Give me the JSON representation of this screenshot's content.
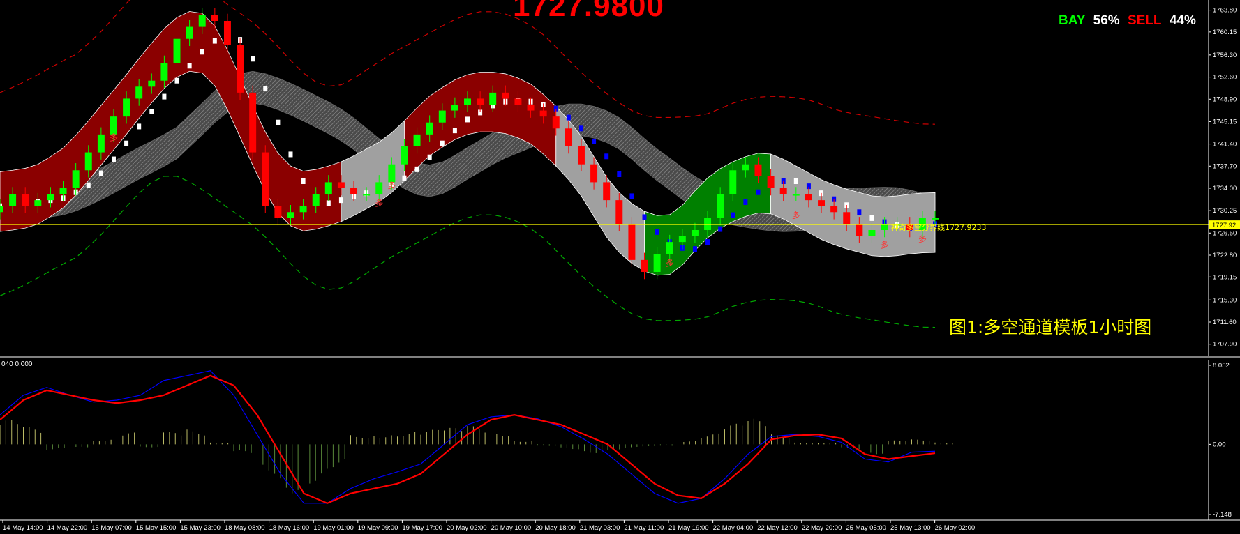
{
  "header": {
    "current_price": "1727.9800",
    "bay_label": "BAY",
    "bay_pct": "56%",
    "sell_label": "SELL",
    "sell_pct": "44%"
  },
  "caption": "图1:多空通道模板1小时图",
  "indicator_label": "040 0.000",
  "threshold_line_label": "神奇多空分界线1727.9233",
  "current_price_tag": "1727.92",
  "colors": {
    "background": "#000000",
    "bull_candle": "#00ff00",
    "bear_candle": "#ff0000",
    "bull_channel": "#8b0000",
    "bear_channel": "#008000",
    "neutral_channel": "#a0a0a0",
    "threshold_line": "#ffff00",
    "outer_band_top": "#cc0000",
    "outer_band_bottom": "#00aa00",
    "macd_signal": "#ff0000",
    "macd_line": "#0000ff",
    "histogram": "#bbbb66"
  },
  "chart_data": [
    {
      "type": "candlestick",
      "title": "",
      "ylim": [
        1706.0,
        1765.5
      ],
      "y_ticks": [
        "1763.80",
        "1760.15",
        "1756.30",
        "1752.60",
        "1748.90",
        "1745.15",
        "1741.40",
        "1737.70",
        "1734.00",
        "1730.25",
        "1726.50",
        "1722.80",
        "1719.15",
        "1715.30",
        "1711.60",
        "1707.90"
      ],
      "threshold_value": 1727.92,
      "x_ticks": [
        "14 May 14:00",
        "14 May 22:00",
        "15 May 07:00",
        "15 May 15:00",
        "15 May 23:00",
        "18 May 08:00",
        "18 May 16:00",
        "19 May 01:00",
        "19 May 09:00",
        "19 May 17:00",
        "20 May 02:00",
        "20 May 10:00",
        "20 May 18:00",
        "21 May 03:00",
        "21 May 11:00",
        "21 May 19:00",
        "22 May 04:00",
        "22 May 12:00",
        "22 May 20:00",
        "25 May 05:00",
        "25 May 13:00",
        "26 May 02:00"
      ],
      "close_path": [
        1731,
        1733,
        1731,
        1732,
        1733,
        1734,
        1737,
        1740,
        1743,
        1746,
        1749,
        1751,
        1752,
        1755,
        1759,
        1761,
        1763,
        1762,
        1758,
        1750,
        1740,
        1731,
        1729,
        1730,
        1731,
        1733,
        1735,
        1734,
        1733,
        1733,
        1735,
        1738,
        1741,
        1743,
        1745,
        1747,
        1748,
        1749,
        1748,
        1750,
        1749,
        1748,
        1747,
        1746,
        1744,
        1741,
        1738,
        1735,
        1732,
        1728,
        1722,
        1720,
        1723,
        1725,
        1726,
        1727,
        1729,
        1733,
        1737,
        1738,
        1736,
        1734,
        1733,
        1733,
        1732,
        1731,
        1730,
        1728,
        1726,
        1727,
        1728,
        1728,
        1727,
        1729,
        1729
      ],
      "channel_segments": [
        {
          "from": 0,
          "to": 27,
          "state": "bull"
        },
        {
          "from": 27,
          "to": 32,
          "state": "neutral"
        },
        {
          "from": 32,
          "to": 44,
          "state": "bull"
        },
        {
          "from": 44,
          "to": 51,
          "state": "neutral"
        },
        {
          "from": 51,
          "to": 61,
          "state": "bear"
        },
        {
          "from": 61,
          "to": 75,
          "state": "neutral"
        }
      ],
      "signal_marks": [
        "多",
        "多",
        "多",
        "多",
        "多",
        "多",
        "多"
      ]
    },
    {
      "type": "macd",
      "ylim": [
        -7.148,
        8.052
      ],
      "y_ticks": [
        "8.052",
        "0.00",
        "-7.148"
      ],
      "signal": [
        2.5,
        4.5,
        5.5,
        5,
        4.5,
        4.2,
        4.5,
        5,
        6,
        7,
        6,
        3,
        -1,
        -5,
        -6,
        -5,
        -4.5,
        -4,
        -3,
        -1,
        1,
        2.5,
        3,
        2.5,
        2,
        1,
        0,
        -2,
        -4,
        -5.2,
        -5.5,
        -4,
        -2,
        0.5,
        0.9,
        1.0,
        0.6,
        -1,
        -1.5,
        -1.2,
        -0.9
      ],
      "macd": [
        3,
        5,
        5.8,
        5,
        4.3,
        4.5,
        5,
        6.5,
        7,
        7.5,
        5,
        1,
        -3,
        -6,
        -6,
        -4.5,
        -3.5,
        -2.8,
        -2,
        0,
        2,
        2.8,
        3,
        2.6,
        1.8,
        0.5,
        -1,
        -3,
        -5,
        -6,
        -5.5,
        -3.5,
        -1,
        0.8,
        1.0,
        0.8,
        0.2,
        -1.5,
        -1.8,
        -0.8,
        -0.7
      ],
      "histogram": [
        2.5,
        1.8,
        -0.6,
        -0.4,
        0.5,
        1.2,
        -0.3,
        1.3,
        1.5,
        0.2,
        -1,
        -3,
        -5,
        -4,
        -2.5,
        1,
        1.1,
        1.3,
        1.5,
        1.7,
        1.9,
        1.3,
        0.4,
        -0.2,
        -0.5,
        -0.9,
        -0.6,
        -0.3,
        -0.2,
        0.4,
        1.1,
        2.1,
        2.6,
        1.0,
        0.2,
        0.2,
        -0.5,
        -1.0,
        0.4,
        0.5,
        0.2
      ]
    }
  ]
}
